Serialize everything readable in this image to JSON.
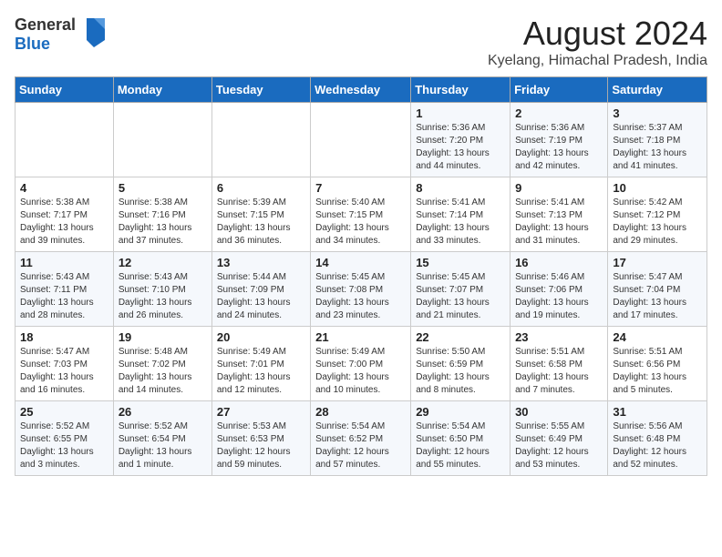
{
  "header": {
    "logo_general": "General",
    "logo_blue": "Blue",
    "month": "August 2024",
    "location": "Kyelang, Himachal Pradesh, India"
  },
  "weekdays": [
    "Sunday",
    "Monday",
    "Tuesday",
    "Wednesday",
    "Thursday",
    "Friday",
    "Saturday"
  ],
  "weeks": [
    [
      {
        "day": "",
        "info": ""
      },
      {
        "day": "",
        "info": ""
      },
      {
        "day": "",
        "info": ""
      },
      {
        "day": "",
        "info": ""
      },
      {
        "day": "1",
        "info": "Sunrise: 5:36 AM\nSunset: 7:20 PM\nDaylight: 13 hours\nand 44 minutes."
      },
      {
        "day": "2",
        "info": "Sunrise: 5:36 AM\nSunset: 7:19 PM\nDaylight: 13 hours\nand 42 minutes."
      },
      {
        "day": "3",
        "info": "Sunrise: 5:37 AM\nSunset: 7:18 PM\nDaylight: 13 hours\nand 41 minutes."
      }
    ],
    [
      {
        "day": "4",
        "info": "Sunrise: 5:38 AM\nSunset: 7:17 PM\nDaylight: 13 hours\nand 39 minutes."
      },
      {
        "day": "5",
        "info": "Sunrise: 5:38 AM\nSunset: 7:16 PM\nDaylight: 13 hours\nand 37 minutes."
      },
      {
        "day": "6",
        "info": "Sunrise: 5:39 AM\nSunset: 7:15 PM\nDaylight: 13 hours\nand 36 minutes."
      },
      {
        "day": "7",
        "info": "Sunrise: 5:40 AM\nSunset: 7:15 PM\nDaylight: 13 hours\nand 34 minutes."
      },
      {
        "day": "8",
        "info": "Sunrise: 5:41 AM\nSunset: 7:14 PM\nDaylight: 13 hours\nand 33 minutes."
      },
      {
        "day": "9",
        "info": "Sunrise: 5:41 AM\nSunset: 7:13 PM\nDaylight: 13 hours\nand 31 minutes."
      },
      {
        "day": "10",
        "info": "Sunrise: 5:42 AM\nSunset: 7:12 PM\nDaylight: 13 hours\nand 29 minutes."
      }
    ],
    [
      {
        "day": "11",
        "info": "Sunrise: 5:43 AM\nSunset: 7:11 PM\nDaylight: 13 hours\nand 28 minutes."
      },
      {
        "day": "12",
        "info": "Sunrise: 5:43 AM\nSunset: 7:10 PM\nDaylight: 13 hours\nand 26 minutes."
      },
      {
        "day": "13",
        "info": "Sunrise: 5:44 AM\nSunset: 7:09 PM\nDaylight: 13 hours\nand 24 minutes."
      },
      {
        "day": "14",
        "info": "Sunrise: 5:45 AM\nSunset: 7:08 PM\nDaylight: 13 hours\nand 23 minutes."
      },
      {
        "day": "15",
        "info": "Sunrise: 5:45 AM\nSunset: 7:07 PM\nDaylight: 13 hours\nand 21 minutes."
      },
      {
        "day": "16",
        "info": "Sunrise: 5:46 AM\nSunset: 7:06 PM\nDaylight: 13 hours\nand 19 minutes."
      },
      {
        "day": "17",
        "info": "Sunrise: 5:47 AM\nSunset: 7:04 PM\nDaylight: 13 hours\nand 17 minutes."
      }
    ],
    [
      {
        "day": "18",
        "info": "Sunrise: 5:47 AM\nSunset: 7:03 PM\nDaylight: 13 hours\nand 16 minutes."
      },
      {
        "day": "19",
        "info": "Sunrise: 5:48 AM\nSunset: 7:02 PM\nDaylight: 13 hours\nand 14 minutes."
      },
      {
        "day": "20",
        "info": "Sunrise: 5:49 AM\nSunset: 7:01 PM\nDaylight: 13 hours\nand 12 minutes."
      },
      {
        "day": "21",
        "info": "Sunrise: 5:49 AM\nSunset: 7:00 PM\nDaylight: 13 hours\nand 10 minutes."
      },
      {
        "day": "22",
        "info": "Sunrise: 5:50 AM\nSunset: 6:59 PM\nDaylight: 13 hours\nand 8 minutes."
      },
      {
        "day": "23",
        "info": "Sunrise: 5:51 AM\nSunset: 6:58 PM\nDaylight: 13 hours\nand 7 minutes."
      },
      {
        "day": "24",
        "info": "Sunrise: 5:51 AM\nSunset: 6:56 PM\nDaylight: 13 hours\nand 5 minutes."
      }
    ],
    [
      {
        "day": "25",
        "info": "Sunrise: 5:52 AM\nSunset: 6:55 PM\nDaylight: 13 hours\nand 3 minutes."
      },
      {
        "day": "26",
        "info": "Sunrise: 5:52 AM\nSunset: 6:54 PM\nDaylight: 13 hours\nand 1 minute."
      },
      {
        "day": "27",
        "info": "Sunrise: 5:53 AM\nSunset: 6:53 PM\nDaylight: 12 hours\nand 59 minutes."
      },
      {
        "day": "28",
        "info": "Sunrise: 5:54 AM\nSunset: 6:52 PM\nDaylight: 12 hours\nand 57 minutes."
      },
      {
        "day": "29",
        "info": "Sunrise: 5:54 AM\nSunset: 6:50 PM\nDaylight: 12 hours\nand 55 minutes."
      },
      {
        "day": "30",
        "info": "Sunrise: 5:55 AM\nSunset: 6:49 PM\nDaylight: 12 hours\nand 53 minutes."
      },
      {
        "day": "31",
        "info": "Sunrise: 5:56 AM\nSunset: 6:48 PM\nDaylight: 12 hours\nand 52 minutes."
      }
    ]
  ]
}
